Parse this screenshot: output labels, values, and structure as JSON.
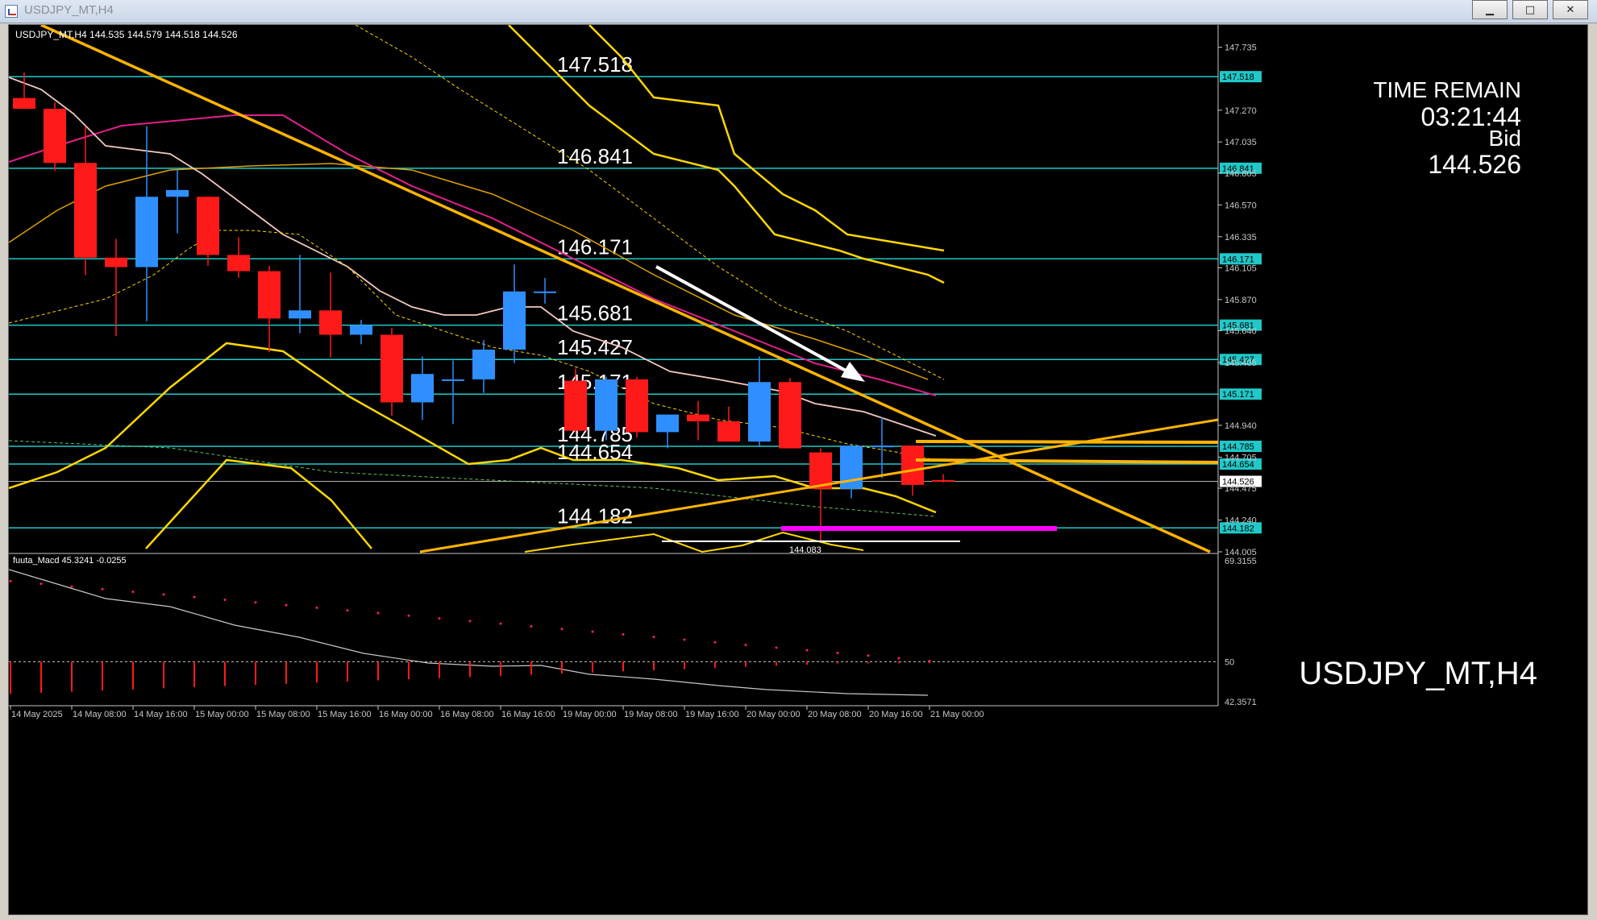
{
  "window": {
    "title": "USDJPY_MT,H4",
    "minimize_glyph": "▁",
    "maximize_glyph": "□",
    "close_glyph": "✕"
  },
  "chart": {
    "header": "USDJPY_MT,H4  144.535 144.579 144.518 144.526",
    "watermark": "USDJPY_MT,H4",
    "time_remain_label": "TIME REMAIN",
    "time_remain_value": "03:21:44",
    "bid_label": "Bid",
    "bid_value": "144.526",
    "low_marker_label": "144.083",
    "colors": {
      "background": "#000000",
      "bull_candle": "#2f8fff",
      "bear_candle": "#ff1a1a",
      "level_line": "#20c8c8",
      "channel": "#ffd700",
      "trendline": "#ffb400",
      "magenta_line": "#e0208c",
      "pink_line": "#ff00ff",
      "white": "#ffffff"
    }
  },
  "chart_data": [
    {
      "type": "candlestick",
      "symbol": "USDJPY_MT",
      "timeframe": "H4",
      "ylim": [
        144.005,
        147.9
      ],
      "price_ticks": [
        "147.735",
        "147.270",
        "147.035",
        "146.805",
        "146.570",
        "146.335",
        "146.105",
        "145.870",
        "145.640",
        "145.405",
        "144.940",
        "144.705",
        "144.475",
        "144.240",
        "144.005"
      ],
      "time_ticks": [
        "14 May 2025",
        "14 May 08:00",
        "14 May 16:00",
        "15 May 00:00",
        "15 May 08:00",
        "15 May 16:00",
        "16 May 00:00",
        "16 May 08:00",
        "16 May 16:00",
        "19 May 00:00",
        "19 May 08:00",
        "19 May 16:00",
        "20 May 00:00",
        "20 May 08:00",
        "20 May 16:00",
        "21 May 00:00"
      ],
      "levels": [
        {
          "price": 147.518,
          "label": "147.518",
          "tag": "147.518"
        },
        {
          "price": 146.841,
          "label": "146.841",
          "tag": "146.841"
        },
        {
          "price": 146.171,
          "label": "146.171",
          "tag": "146.171"
        },
        {
          "price": 145.681,
          "label": "145.681",
          "tag": "145.681"
        },
        {
          "price": 145.427,
          "label": "145.427",
          "tag": "145.427"
        },
        {
          "price": 145.171,
          "label": "145.171",
          "tag": "145.171"
        },
        {
          "price": 144.785,
          "label": "144.785",
          "tag": "144.785"
        },
        {
          "price": 144.654,
          "label": "144.654",
          "tag": "144.654"
        },
        {
          "price": 144.182,
          "label": "144.182",
          "tag": "144.182"
        }
      ],
      "current_price": {
        "price": 144.526,
        "tag": "144.526"
      },
      "low_marker": 144.083,
      "candles": [
        {
          "o": 147.36,
          "h": 147.55,
          "l": 147.28,
          "c": 147.28
        },
        {
          "o": 147.28,
          "h": 147.33,
          "l": 146.82,
          "c": 146.88
        },
        {
          "o": 146.88,
          "h": 147.15,
          "l": 146.05,
          "c": 146.18
        },
        {
          "o": 146.18,
          "h": 146.32,
          "l": 145.6,
          "c": 146.11
        },
        {
          "o": 146.11,
          "h": 147.15,
          "l": 145.71,
          "c": 146.63
        },
        {
          "o": 146.63,
          "h": 146.83,
          "l": 146.36,
          "c": 146.68
        },
        {
          "o": 146.63,
          "h": 146.63,
          "l": 146.12,
          "c": 146.2
        },
        {
          "o": 146.2,
          "h": 146.33,
          "l": 146.03,
          "c": 146.08
        },
        {
          "o": 146.08,
          "h": 146.12,
          "l": 145.48,
          "c": 145.73
        },
        {
          "o": 145.73,
          "h": 146.2,
          "l": 145.62,
          "c": 145.79
        },
        {
          "o": 145.79,
          "h": 146.07,
          "l": 145.44,
          "c": 145.61
        },
        {
          "o": 145.61,
          "h": 145.72,
          "l": 145.54,
          "c": 145.68
        },
        {
          "o": 145.61,
          "h": 145.66,
          "l": 145.01,
          "c": 145.11
        },
        {
          "o": 145.11,
          "h": 145.45,
          "l": 144.98,
          "c": 145.32
        },
        {
          "o": 145.28,
          "h": 145.42,
          "l": 144.95,
          "c": 145.28
        },
        {
          "o": 145.28,
          "h": 145.57,
          "l": 145.18,
          "c": 145.5
        },
        {
          "o": 145.5,
          "h": 146.13,
          "l": 145.4,
          "c": 145.93
        },
        {
          "o": 145.93,
          "h": 146.03,
          "l": 145.84,
          "c": 145.93
        },
        {
          "o": 145.27,
          "h": 145.36,
          "l": 144.89,
          "c": 144.9
        },
        {
          "o": 144.9,
          "h": 145.3,
          "l": 144.83,
          "c": 145.28
        },
        {
          "o": 145.28,
          "h": 145.3,
          "l": 144.85,
          "c": 144.89
        },
        {
          "o": 144.89,
          "h": 145.01,
          "l": 144.77,
          "c": 145.02
        },
        {
          "o": 145.02,
          "h": 145.12,
          "l": 144.83,
          "c": 144.97
        },
        {
          "o": 144.97,
          "h": 145.08,
          "l": 144.82,
          "c": 144.82
        },
        {
          "o": 144.82,
          "h": 145.45,
          "l": 144.78,
          "c": 145.26
        },
        {
          "o": 145.26,
          "h": 145.29,
          "l": 144.77,
          "c": 144.77
        },
        {
          "o": 144.74,
          "h": 144.77,
          "l": 144.08,
          "c": 144.47
        },
        {
          "o": 144.47,
          "h": 144.8,
          "l": 144.4,
          "c": 144.79
        },
        {
          "o": 144.79,
          "h": 145.0,
          "l": 144.55,
          "c": 144.79
        },
        {
          "o": 144.79,
          "h": 144.79,
          "l": 144.42,
          "c": 144.5
        },
        {
          "o": 144.535,
          "h": 144.579,
          "l": 144.518,
          "c": 144.526
        }
      ]
    },
    {
      "type": "line",
      "title": "fuuta_Macd 45.3241 -0.0255",
      "ylim": [
        42.3571,
        69.3155
      ],
      "y_ticks": [
        "69.3155",
        "50",
        "42.3571"
      ],
      "reference_level": 50
    }
  ]
}
